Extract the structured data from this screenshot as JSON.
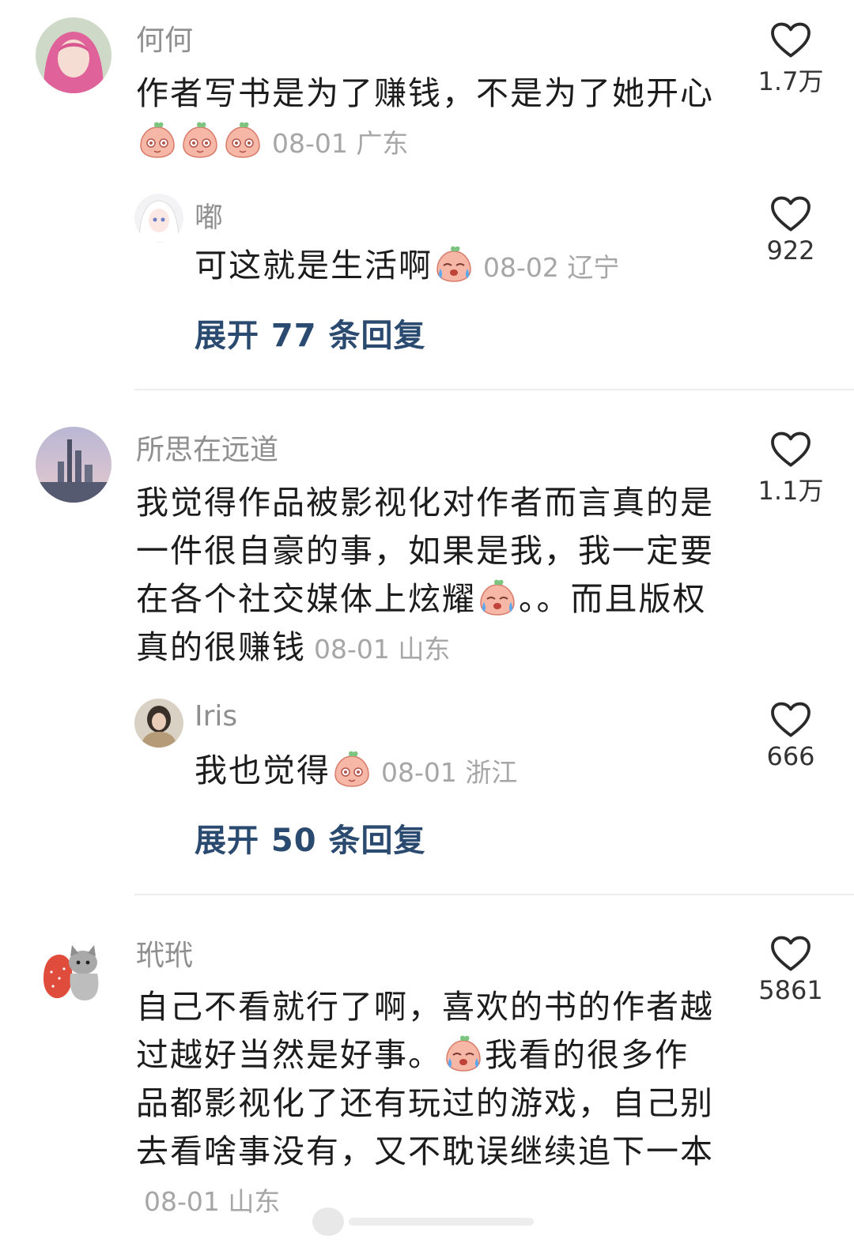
{
  "threads": [
    {
      "user": "何何",
      "text": "作者写书是为了赚钱，不是为了她开心",
      "meta": "08-01 广东",
      "likes": "1.7万",
      "reply": {
        "user": "嘟",
        "text": "可这就是生活啊",
        "meta": "08-02 辽宁",
        "likes": "922"
      },
      "expand_label": "展开 77 条回复"
    },
    {
      "user": "所思在远道",
      "text_part1": "我觉得作品被影视化对作者而言真的是一件很自豪的事，如果是我，我一定要在各个社交媒体上炫耀",
      "text_part2": "。。而且版权真的很赚钱",
      "meta": "08-01 山东",
      "likes": "1.1万",
      "reply": {
        "user": "Iris",
        "text": "我也觉得",
        "meta": "08-01 浙江",
        "likes": "666"
      },
      "expand_label": "展开 50 条回复"
    },
    {
      "user": "玳玳",
      "text_part1": "自己不看就行了啊，喜欢的书的作者越过越好当然是好事。",
      "text_part2": "我看的很多作品都影视化了还有玩过的游戏，自己别去看啥事没有，又不耽误继续追下一本",
      "meta": "08-01 山东",
      "likes": "5861"
    }
  ],
  "icons": {
    "like": "heart-outline-icon",
    "emoji_peach": "peach-emoji-icon"
  },
  "colors": {
    "username": "#8f8f8f",
    "meta": "#a6a6a6",
    "expand_link": "#2b4a6f",
    "divider": "#ececec"
  }
}
